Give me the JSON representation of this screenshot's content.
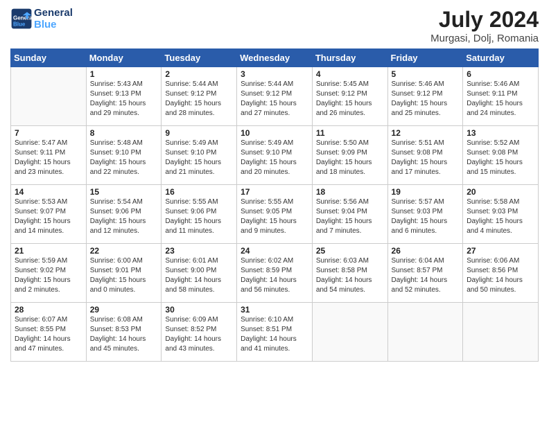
{
  "header": {
    "logo_line1": "General",
    "logo_line2": "Blue",
    "month_year": "July 2024",
    "location": "Murgasi, Dolj, Romania"
  },
  "weekdays": [
    "Sunday",
    "Monday",
    "Tuesday",
    "Wednesday",
    "Thursday",
    "Friday",
    "Saturday"
  ],
  "weeks": [
    [
      {
        "day": "",
        "sunrise": "",
        "sunset": "",
        "daylight": ""
      },
      {
        "day": "1",
        "sunrise": "Sunrise: 5:43 AM",
        "sunset": "Sunset: 9:13 PM",
        "daylight": "Daylight: 15 hours and 29 minutes."
      },
      {
        "day": "2",
        "sunrise": "Sunrise: 5:44 AM",
        "sunset": "Sunset: 9:12 PM",
        "daylight": "Daylight: 15 hours and 28 minutes."
      },
      {
        "day": "3",
        "sunrise": "Sunrise: 5:44 AM",
        "sunset": "Sunset: 9:12 PM",
        "daylight": "Daylight: 15 hours and 27 minutes."
      },
      {
        "day": "4",
        "sunrise": "Sunrise: 5:45 AM",
        "sunset": "Sunset: 9:12 PM",
        "daylight": "Daylight: 15 hours and 26 minutes."
      },
      {
        "day": "5",
        "sunrise": "Sunrise: 5:46 AM",
        "sunset": "Sunset: 9:12 PM",
        "daylight": "Daylight: 15 hours and 25 minutes."
      },
      {
        "day": "6",
        "sunrise": "Sunrise: 5:46 AM",
        "sunset": "Sunset: 9:11 PM",
        "daylight": "Daylight: 15 hours and 24 minutes."
      }
    ],
    [
      {
        "day": "7",
        "sunrise": "Sunrise: 5:47 AM",
        "sunset": "Sunset: 9:11 PM",
        "daylight": "Daylight: 15 hours and 23 minutes."
      },
      {
        "day": "8",
        "sunrise": "Sunrise: 5:48 AM",
        "sunset": "Sunset: 9:10 PM",
        "daylight": "Daylight: 15 hours and 22 minutes."
      },
      {
        "day": "9",
        "sunrise": "Sunrise: 5:49 AM",
        "sunset": "Sunset: 9:10 PM",
        "daylight": "Daylight: 15 hours and 21 minutes."
      },
      {
        "day": "10",
        "sunrise": "Sunrise: 5:49 AM",
        "sunset": "Sunset: 9:10 PM",
        "daylight": "Daylight: 15 hours and 20 minutes."
      },
      {
        "day": "11",
        "sunrise": "Sunrise: 5:50 AM",
        "sunset": "Sunset: 9:09 PM",
        "daylight": "Daylight: 15 hours and 18 minutes."
      },
      {
        "day": "12",
        "sunrise": "Sunrise: 5:51 AM",
        "sunset": "Sunset: 9:08 PM",
        "daylight": "Daylight: 15 hours and 17 minutes."
      },
      {
        "day": "13",
        "sunrise": "Sunrise: 5:52 AM",
        "sunset": "Sunset: 9:08 PM",
        "daylight": "Daylight: 15 hours and 15 minutes."
      }
    ],
    [
      {
        "day": "14",
        "sunrise": "Sunrise: 5:53 AM",
        "sunset": "Sunset: 9:07 PM",
        "daylight": "Daylight: 15 hours and 14 minutes."
      },
      {
        "day": "15",
        "sunrise": "Sunrise: 5:54 AM",
        "sunset": "Sunset: 9:06 PM",
        "daylight": "Daylight: 15 hours and 12 minutes."
      },
      {
        "day": "16",
        "sunrise": "Sunrise: 5:55 AM",
        "sunset": "Sunset: 9:06 PM",
        "daylight": "Daylight: 15 hours and 11 minutes."
      },
      {
        "day": "17",
        "sunrise": "Sunrise: 5:55 AM",
        "sunset": "Sunset: 9:05 PM",
        "daylight": "Daylight: 15 hours and 9 minutes."
      },
      {
        "day": "18",
        "sunrise": "Sunrise: 5:56 AM",
        "sunset": "Sunset: 9:04 PM",
        "daylight": "Daylight: 15 hours and 7 minutes."
      },
      {
        "day": "19",
        "sunrise": "Sunrise: 5:57 AM",
        "sunset": "Sunset: 9:03 PM",
        "daylight": "Daylight: 15 hours and 6 minutes."
      },
      {
        "day": "20",
        "sunrise": "Sunrise: 5:58 AM",
        "sunset": "Sunset: 9:03 PM",
        "daylight": "Daylight: 15 hours and 4 minutes."
      }
    ],
    [
      {
        "day": "21",
        "sunrise": "Sunrise: 5:59 AM",
        "sunset": "Sunset: 9:02 PM",
        "daylight": "Daylight: 15 hours and 2 minutes."
      },
      {
        "day": "22",
        "sunrise": "Sunrise: 6:00 AM",
        "sunset": "Sunset: 9:01 PM",
        "daylight": "Daylight: 15 hours and 0 minutes."
      },
      {
        "day": "23",
        "sunrise": "Sunrise: 6:01 AM",
        "sunset": "Sunset: 9:00 PM",
        "daylight": "Daylight: 14 hours and 58 minutes."
      },
      {
        "day": "24",
        "sunrise": "Sunrise: 6:02 AM",
        "sunset": "Sunset: 8:59 PM",
        "daylight": "Daylight: 14 hours and 56 minutes."
      },
      {
        "day": "25",
        "sunrise": "Sunrise: 6:03 AM",
        "sunset": "Sunset: 8:58 PM",
        "daylight": "Daylight: 14 hours and 54 minutes."
      },
      {
        "day": "26",
        "sunrise": "Sunrise: 6:04 AM",
        "sunset": "Sunset: 8:57 PM",
        "daylight": "Daylight: 14 hours and 52 minutes."
      },
      {
        "day": "27",
        "sunrise": "Sunrise: 6:06 AM",
        "sunset": "Sunset: 8:56 PM",
        "daylight": "Daylight: 14 hours and 50 minutes."
      }
    ],
    [
      {
        "day": "28",
        "sunrise": "Sunrise: 6:07 AM",
        "sunset": "Sunset: 8:55 PM",
        "daylight": "Daylight: 14 hours and 47 minutes."
      },
      {
        "day": "29",
        "sunrise": "Sunrise: 6:08 AM",
        "sunset": "Sunset: 8:53 PM",
        "daylight": "Daylight: 14 hours and 45 minutes."
      },
      {
        "day": "30",
        "sunrise": "Sunrise: 6:09 AM",
        "sunset": "Sunset: 8:52 PM",
        "daylight": "Daylight: 14 hours and 43 minutes."
      },
      {
        "day": "31",
        "sunrise": "Sunrise: 6:10 AM",
        "sunset": "Sunset: 8:51 PM",
        "daylight": "Daylight: 14 hours and 41 minutes."
      },
      {
        "day": "",
        "sunrise": "",
        "sunset": "",
        "daylight": ""
      },
      {
        "day": "",
        "sunrise": "",
        "sunset": "",
        "daylight": ""
      },
      {
        "day": "",
        "sunrise": "",
        "sunset": "",
        "daylight": ""
      }
    ]
  ]
}
